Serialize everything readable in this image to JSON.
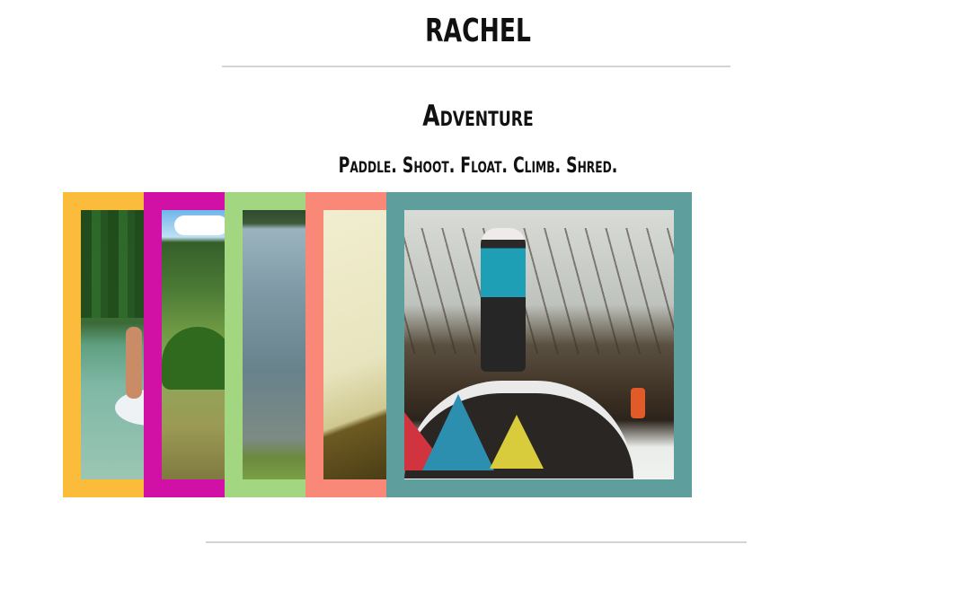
{
  "site": {
    "title": "RACHEL"
  },
  "section": {
    "title": "Adventure",
    "tagline": "Paddle. Shoot. Float. Climb. Shred."
  },
  "gallery": {
    "cards": [
      {
        "name": "paddleboard-photo",
        "frame_color": "#fbbb3b"
      },
      {
        "name": "meadow-photo",
        "frame_color": "#d111a6"
      },
      {
        "name": "lake-photo",
        "frame_color": "#a3d680"
      },
      {
        "name": "rock-photo",
        "frame_color": "#f98879"
      },
      {
        "name": "snowboard-photo",
        "frame_color": "#5e9e9c"
      }
    ]
  },
  "colors": {
    "text": "#111111",
    "rule": "#d4d4d4",
    "background": "#ffffff"
  }
}
